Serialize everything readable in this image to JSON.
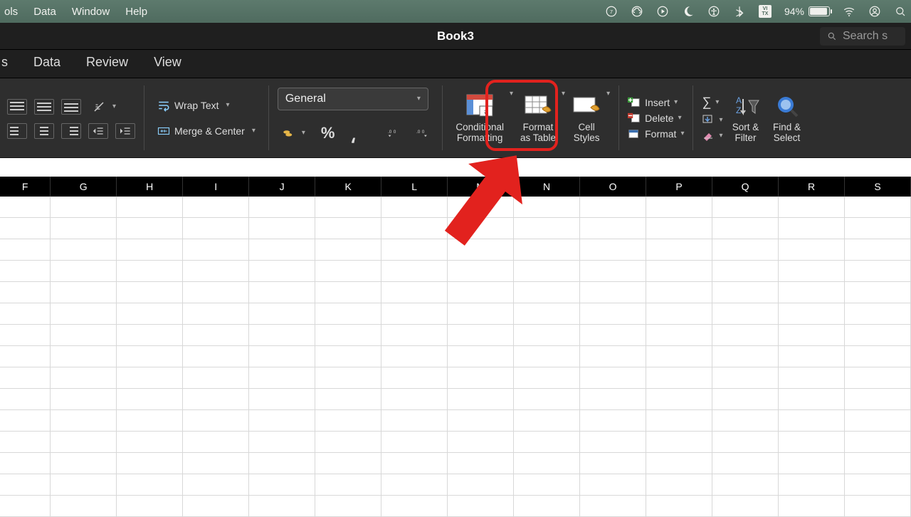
{
  "mac_menu": {
    "items": [
      "ols",
      "Data",
      "Window",
      "Help"
    ],
    "battery": "94%"
  },
  "titlebar": {
    "title": "Book3",
    "search_placeholder": "Search s"
  },
  "ribbon_tabs": [
    "s",
    "Data",
    "Review",
    "View"
  ],
  "ribbon": {
    "wrap_text": "Wrap Text",
    "merge_center": "Merge & Center",
    "number_format": "General",
    "percent": "%",
    "cond_fmt_l1": "Conditional",
    "cond_fmt_l2": "Formatting",
    "fmt_table_l1": "Format",
    "fmt_table_l2": "as Table",
    "cell_styles_l1": "Cell",
    "cell_styles_l2": "Styles",
    "insert": "Insert",
    "delete": "Delete",
    "format": "Format",
    "sort_filter_l1": "Sort &",
    "sort_filter_l2": "Filter",
    "find_select_l1": "Find &",
    "find_select_l2": "Select"
  },
  "columns": [
    "F",
    "G",
    "H",
    "I",
    "J",
    "K",
    "L",
    "M",
    "N",
    "O",
    "P",
    "Q",
    "R",
    "S"
  ]
}
